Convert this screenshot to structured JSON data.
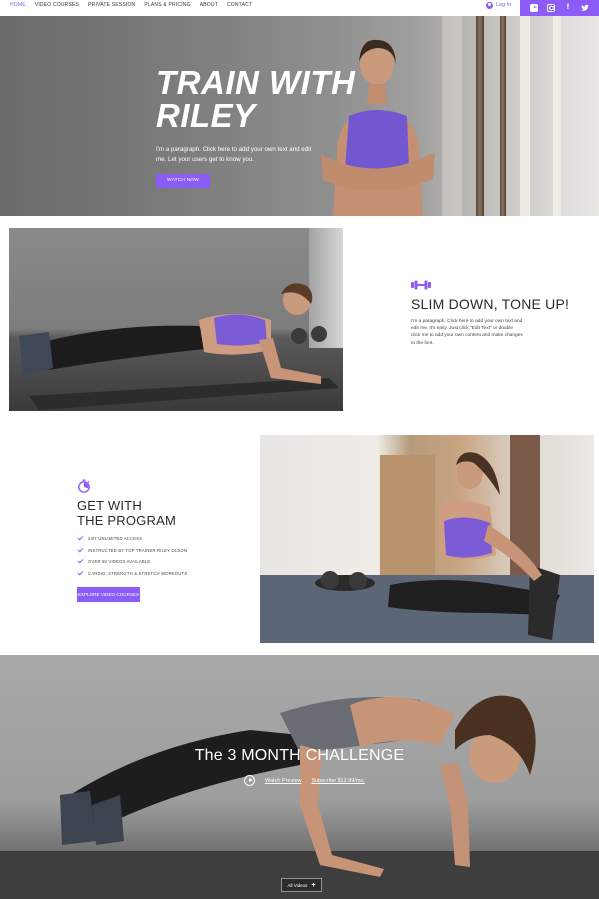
{
  "nav": {
    "links": [
      "HOME",
      "VIDEO COURSES",
      "PRIVATE SESSION",
      "PLANS & PRICING",
      "ABOUT",
      "CONTACT"
    ],
    "active_index": 0,
    "login_label": "Log In",
    "social_icons": [
      "youtube-icon",
      "instagram-icon",
      "facebook-icon",
      "twitter-icon"
    ],
    "accent_color": "#8b5cf6"
  },
  "hero": {
    "title_line1": "TRAIN WITH",
    "title_line2": "RILEY",
    "paragraph": "I'm a paragraph. Click here to add your own text and edit me. Let your users get to know you.",
    "button_label": "WATCH NOW"
  },
  "slim": {
    "icon": "dumbbell-icon",
    "title": "SLIM DOWN, TONE UP!",
    "paragraph": "I'm a paragraph. Click here to add your own text and edit me. It's easy. Just click \"Edit Text\" or double click me to add your own content and make changes to the font."
  },
  "program": {
    "icon": "stopwatch-icon",
    "title_line1": "GET WITH",
    "title_line2": "THE PROGRAM",
    "features": [
      "24/7 UNLIMITED ACCESS",
      "INSTRUCTED BY TOP TRAINER RILEY OLSON",
      "OVER 50 VIDEOS AVAILABLE",
      "CARDIO, STRENGTH & STRETCH WORKOUTS"
    ],
    "button_label": "EXPLORE VIDEO COURSES"
  },
  "challenge": {
    "title": "The 3 MONTH CHALLENGE",
    "watch_label": "Watch Preview",
    "subscribe_label": "Subscribe $12.99/mo.",
    "all_videos_label": "All Videos"
  }
}
